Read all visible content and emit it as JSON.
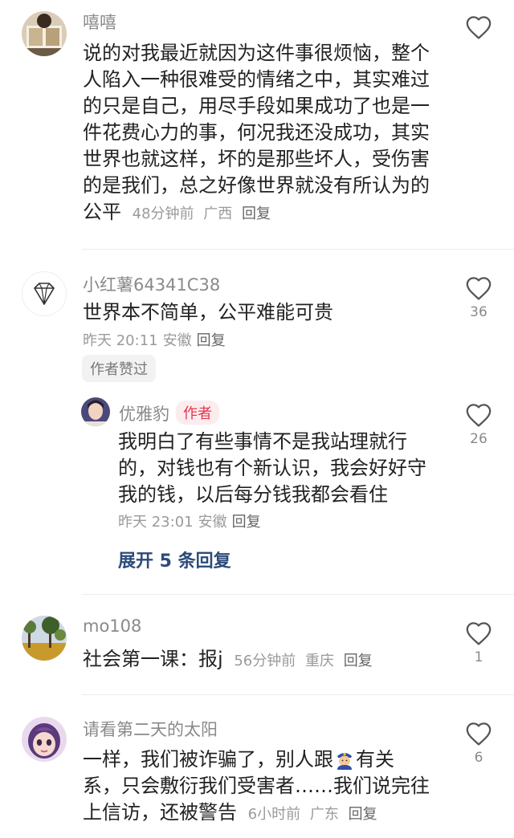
{
  "comments": [
    {
      "username": "嘻嘻",
      "text": "说的对我最近就因为这件事很烦恼，整个人陷入一种很难受的情绪之中，其实难过的只是自己，用尽手段如果成功了也是一件花费心力的事，何况我还没成功，其实世界也就这样，坏的是那些坏人，受伤害的是我们，总之好像世界就没有所认为的公平",
      "time": "48分钟前",
      "location": "广西",
      "reply": "回复"
    },
    {
      "username": "小红薯64341C38",
      "text": "世界本不简单，公平难能可贵",
      "time": "昨天 20:11",
      "location": "安徽",
      "reply": "回复",
      "likes": "36",
      "author_liked": "作者赞过",
      "sub_reply": {
        "username": "优雅豹",
        "badge": "作者",
        "text": "我明白了有些事情不是我站理就行的，对钱也有个新认识，我会好好守我的钱，以后每分钱我都会看住",
        "time": "昨天 23:01",
        "location": "安徽",
        "reply": "回复",
        "likes": "26"
      },
      "expand": "展开 5 条回复"
    },
    {
      "username": "mo108",
      "text": "社会第一课：报j",
      "time": "56分钟前",
      "location": "重庆",
      "reply": "回复",
      "likes": "1"
    },
    {
      "username": "请看第二天的太阳",
      "text_part1": "一样，我们被诈骗了，别人跟",
      "text_part2": "有关系，只会敷衍我们受害者……我们说完往上信访，还被警告",
      "time": "6小时前",
      "location": "广东",
      "reply": "回复",
      "likes": "6"
    }
  ],
  "icons": {
    "like": "heart-outline-icon",
    "diamond_avatar": "diamond-icon",
    "inline_emoji": "police-officer-emoji"
  }
}
